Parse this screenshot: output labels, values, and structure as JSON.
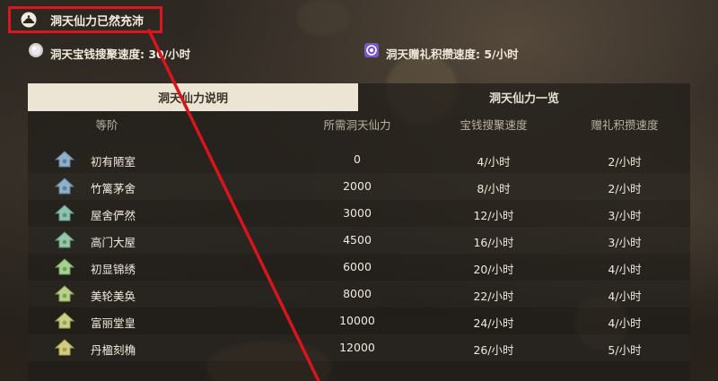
{
  "title": "洞天仙力已然充沛",
  "rates": {
    "coin_label": "洞天宝钱搜聚速度: 30/小时",
    "gift_label": "洞天赠礼积攒速度: 5/小时"
  },
  "tabs": [
    {
      "label": "洞天仙力说明",
      "active": true
    },
    {
      "label": "洞天仙力一览",
      "active": false
    }
  ],
  "table": {
    "headers": [
      "等阶",
      "所需洞天仙力",
      "宝钱搜聚速度",
      "赠礼积攒速度"
    ],
    "rows": [
      {
        "name": "初有陋室",
        "energy": "0",
        "coin": "4/小时",
        "gift": "2/小时"
      },
      {
        "name": "竹篱茅舍",
        "energy": "2000",
        "coin": "8/小时",
        "gift": "2/小时"
      },
      {
        "name": "屋舍俨然",
        "energy": "3000",
        "coin": "12/小时",
        "gift": "3/小时"
      },
      {
        "name": "高门大屋",
        "energy": "4500",
        "coin": "16/小时",
        "gift": "3/小时"
      },
      {
        "name": "初显锦绣",
        "energy": "6000",
        "coin": "20/小时",
        "gift": "4/小时"
      },
      {
        "name": "美轮美奂",
        "energy": "8000",
        "coin": "22/小时",
        "gift": "4/小时"
      },
      {
        "name": "富丽堂皇",
        "energy": "10000",
        "coin": "24/小时",
        "gift": "4/小时"
      },
      {
        "name": "丹楹刻桷",
        "energy": "12000",
        "coin": "26/小时",
        "gift": "5/小时"
      }
    ]
  },
  "colors": {
    "highlight_box": "#e0141e",
    "annotation_line": "#d8141c",
    "tab_active_bg": "#ece5d4"
  },
  "icons": {
    "title": "teapot-icon",
    "coin": "silver-coin-icon",
    "gift": "gift-purple-icon",
    "rank": "house-rank-icon"
  }
}
